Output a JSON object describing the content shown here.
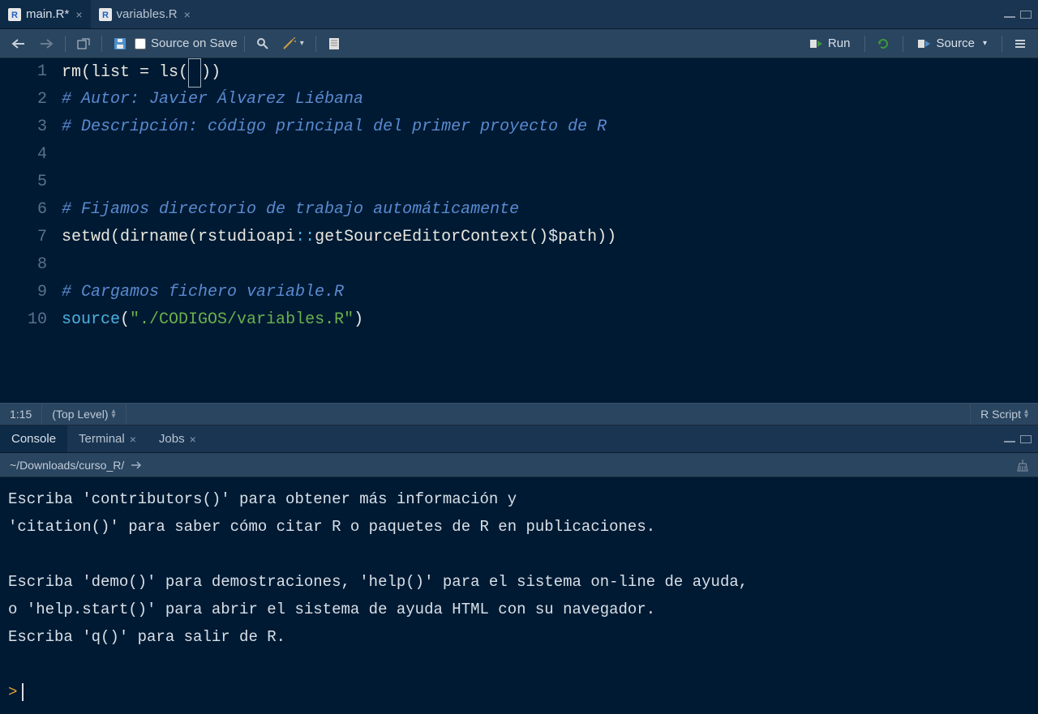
{
  "tabs": [
    {
      "label": "main.R*",
      "active": true
    },
    {
      "label": "variables.R",
      "active": false
    }
  ],
  "toolbar": {
    "source_on_save": "Source on Save",
    "run": "Run",
    "source": "Source"
  },
  "code": {
    "lines": [
      "1",
      "2",
      "3",
      "4",
      "5",
      "6",
      "7",
      "8",
      "9",
      "10"
    ],
    "l1_a": "rm(list ",
    "l1_b": "=",
    "l1_c": " ls(",
    "l1_d": "))",
    "l2": "# Autor: Javier Álvarez Liébana",
    "l3": "# Descripción: código principal del primer proyecto de R",
    "l6": "# Fijamos directorio de trabajo automáticamente",
    "l7_a": "setwd",
    "l7_b": "(",
    "l7_c": "dirname",
    "l7_d": "(rstudioapi",
    "l7_e": "::",
    "l7_f": "getSourceEditorContext",
    "l7_g": "()",
    "l7_h": "$",
    "l7_i": "path))",
    "l9": "# Cargamos fichero variable.R",
    "l10_a": "source",
    "l10_b": "(",
    "l10_c": "\"./CODIGOS/variables.R\"",
    "l10_d": ")"
  },
  "status": {
    "cursor": "1:15",
    "scope": "(Top Level)",
    "language": "R Script"
  },
  "console_tabs": [
    {
      "label": "Console",
      "active": true,
      "closable": false
    },
    {
      "label": "Terminal",
      "active": false,
      "closable": true
    },
    {
      "label": "Jobs",
      "active": false,
      "closable": true
    }
  ],
  "console": {
    "path": "~/Downloads/curso_R/",
    "output": "Escriba 'contributors()' para obtener más información y\n'citation()' para saber cómo citar R o paquetes de R en publicaciones.\n\nEscriba 'demo()' para demostraciones, 'help()' para el sistema on-line de ayuda,\no 'help.start()' para abrir el sistema de ayuda HTML con su navegador.\nEscriba 'q()' para salir de R.\n",
    "prompt": ">"
  }
}
